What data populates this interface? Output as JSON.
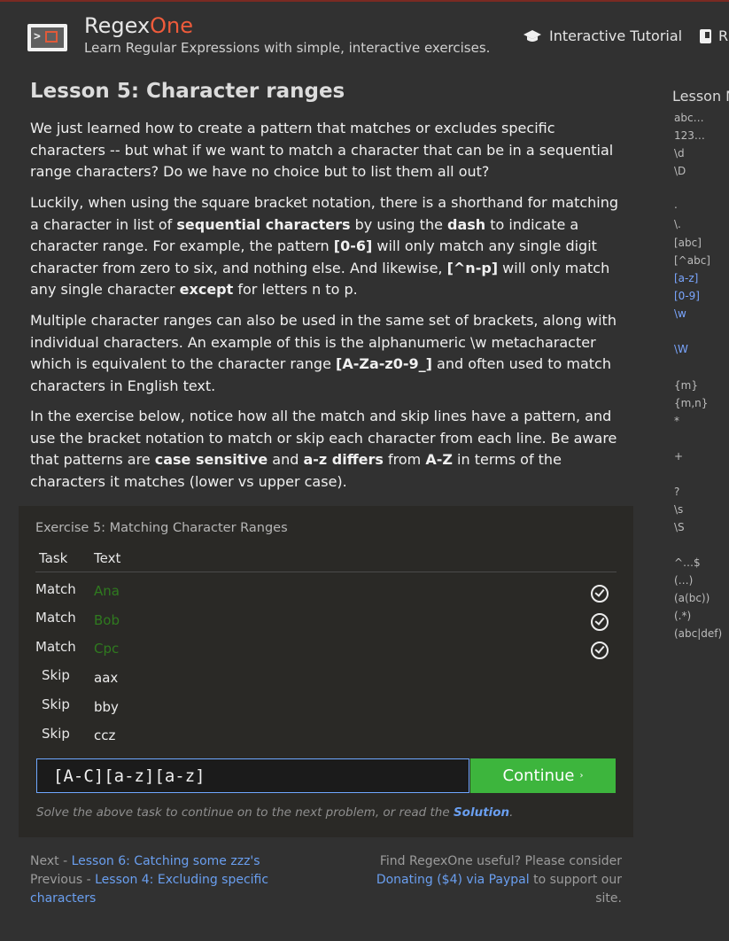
{
  "header": {
    "brand_prefix": "Regex",
    "brand_suffix": "One",
    "tagline": "Learn Regular Expressions with simple, interactive exercises.",
    "nav": [
      {
        "label": "Interactive Tutorial",
        "icon": "graduation-cap-icon"
      },
      {
        "label": "R",
        "icon": "book-icon"
      }
    ]
  },
  "lesson": {
    "title": "Lesson 5: Character ranges",
    "p1": "We just learned how to create a pattern that matches or excludes specific characters -- but what if we want to match a character that can be in a sequential range characters? Do we have no choice but to list them all out?",
    "p2": {
      "t1": "Luckily, when using the square bracket notation, there is a shorthand for matching a character in list of ",
      "b1": "sequential characters",
      "t2": " by using the ",
      "b2": "dash",
      "t3": " to indicate a character range. For example, the pattern ",
      "b3": "[0-6]",
      "t4": " will only match any single digit character from zero to six, and nothing else. And likewise, ",
      "b4": "[^n-p]",
      "t5": " will only match any single character ",
      "b5": "except",
      "t6": " for letters n to p."
    },
    "p3": {
      "t1": "Multiple character ranges can also be used in the same set of brackets, along with individual characters. An example of this is the alphanumeric \\w metacharacter which is equivalent to the character range ",
      "b1": "[A-Za-z0-9_]",
      "t2": " and often used to match characters in English text."
    },
    "p4": {
      "t1": "In the exercise below, notice how all the match and skip lines have a pattern, and use the bracket notation to match or skip each character from each line. Be aware that patterns are ",
      "b1": "case sensitive",
      "t2": " and ",
      "b2": "a-z differs",
      "t3": " from ",
      "b3": "A-Z",
      "t4": " in terms of the characters it matches (lower vs upper case)."
    }
  },
  "sidebar": {
    "title": "Lesson N",
    "items": [
      {
        "label": "abc…"
      },
      {
        "label": "123…"
      },
      {
        "label": "\\d"
      },
      {
        "label": "\\D"
      },
      {
        "label": "."
      },
      {
        "label": "\\."
      },
      {
        "label": "[abc]"
      },
      {
        "label": "[^abc]"
      },
      {
        "label": "[a-z]",
        "active": true
      },
      {
        "label": "[0-9]",
        "active": true
      },
      {
        "label": "\\w",
        "active": true
      },
      {
        "label": "\\W",
        "active": true
      },
      {
        "label": "{m}"
      },
      {
        "label": "{m,n}"
      },
      {
        "label": "*"
      },
      {
        "label": "+"
      },
      {
        "label": "?"
      },
      {
        "label": "\\s"
      },
      {
        "label": "\\S"
      },
      {
        "label": "^…$"
      },
      {
        "label": "(…)"
      },
      {
        "label": "(a(bc))"
      },
      {
        "label": "(.*)"
      },
      {
        "label": "(abc|def)"
      }
    ]
  },
  "exercise": {
    "title": "Exercise 5: Matching Character Ranges",
    "col_task": "Task",
    "col_text": "Text",
    "rows": [
      {
        "task": "Match",
        "text": "Ana",
        "passed": true
      },
      {
        "task": "Match",
        "text": "Bob",
        "passed": true
      },
      {
        "task": "Match",
        "text": "Cpc",
        "passed": true
      },
      {
        "task": "Skip",
        "text": "aax",
        "passed": false
      },
      {
        "task": "Skip",
        "text": "bby",
        "passed": false
      },
      {
        "task": "Skip",
        "text": "ccz",
        "passed": false
      }
    ],
    "input_value": "[A-C][a-z][a-z]",
    "continue_label": "Continue",
    "continue_chevron": "›",
    "hint_text": "Solve the above task to continue on to the next problem, or read the ",
    "hint_link": "Solution",
    "hint_end": "."
  },
  "footer": {
    "next_prefix": "Next - ",
    "next_link": "Lesson 6: Catching some zzz's",
    "prev_prefix": "Previous - ",
    "prev_link_1": "Lesson 4: Excluding specific",
    "prev_link_2": "characters",
    "donate_text": "Find RegexOne useful? Please consider",
    "donate_link": "Donating ($4) via Paypal",
    "donate_suffix": " to support our site."
  },
  "colors": {
    "background": "#313131",
    "brand_accent": "#ef5b3b",
    "link": "#6a9ff0",
    "continue_button": "#3db53d",
    "passed_text": "#2f7a1f"
  }
}
